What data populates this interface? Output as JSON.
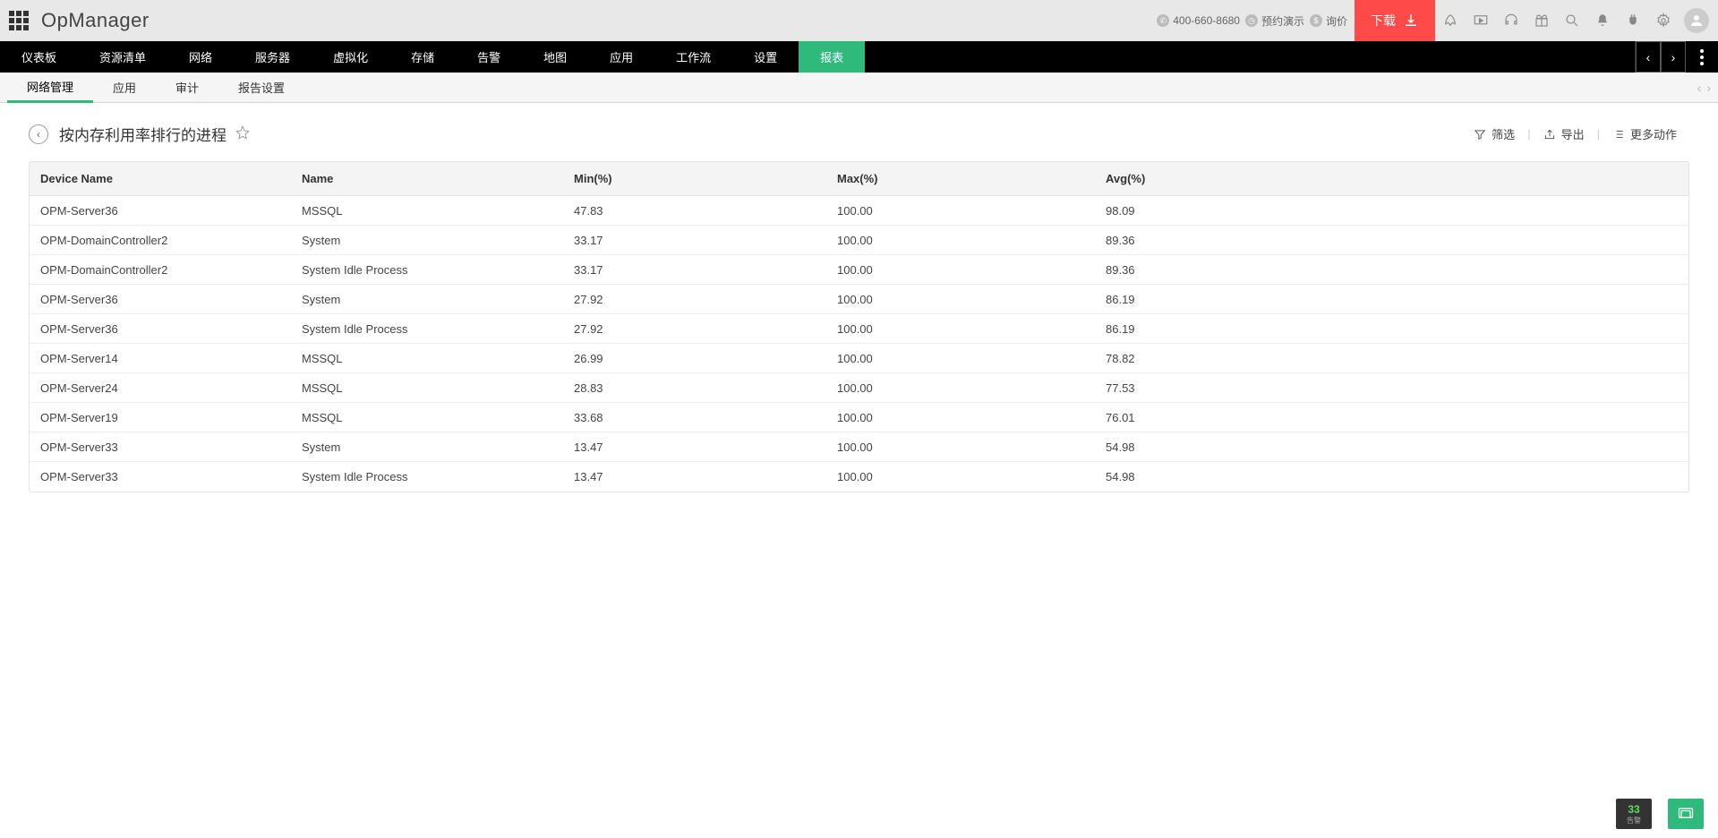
{
  "brand": "OpManager",
  "contact": {
    "phone": "400-660-8680",
    "demo": "预约演示",
    "price": "询价"
  },
  "download_label": "下载",
  "main_nav": [
    "仪表板",
    "资源清单",
    "网络",
    "服务器",
    "虚拟化",
    "存储",
    "告警",
    "地图",
    "应用",
    "工作流",
    "设置",
    "报表"
  ],
  "main_nav_active": 11,
  "sub_nav": [
    "网络管理",
    "应用",
    "审计",
    "报告设置"
  ],
  "sub_nav_active": 0,
  "page_title": "按内存利用率排行的进程",
  "actions": {
    "filter": "筛选",
    "export": "导出",
    "more": "更多动作"
  },
  "columns": [
    "Device Name",
    "Name",
    "Min(%)",
    "Max(%)",
    "Avg(%)"
  ],
  "rows": [
    {
      "device": "OPM-Server36",
      "name": "MSSQL",
      "min": "47.83",
      "max": "100.00",
      "avg": "98.09"
    },
    {
      "device": "OPM-DomainController2",
      "name": "System",
      "min": "33.17",
      "max": "100.00",
      "avg": "89.36"
    },
    {
      "device": "OPM-DomainController2",
      "name": "System Idle Process",
      "min": "33.17",
      "max": "100.00",
      "avg": "89.36"
    },
    {
      "device": "OPM-Server36",
      "name": "System",
      "min": "27.92",
      "max": "100.00",
      "avg": "86.19"
    },
    {
      "device": "OPM-Server36",
      "name": "System Idle Process",
      "min": "27.92",
      "max": "100.00",
      "avg": "86.19"
    },
    {
      "device": "OPM-Server14",
      "name": "MSSQL",
      "min": "26.99",
      "max": "100.00",
      "avg": "78.82"
    },
    {
      "device": "OPM-Server24",
      "name": "MSSQL",
      "min": "28.83",
      "max": "100.00",
      "avg": "77.53"
    },
    {
      "device": "OPM-Server19",
      "name": "MSSQL",
      "min": "33.68",
      "max": "100.00",
      "avg": "76.01"
    },
    {
      "device": "OPM-Server33",
      "name": "System",
      "min": "13.47",
      "max": "100.00",
      "avg": "54.98"
    },
    {
      "device": "OPM-Server33",
      "name": "System Idle Process",
      "min": "13.47",
      "max": "100.00",
      "avg": "54.98"
    }
  ],
  "badge_count": "33",
  "badge_label": "告警"
}
